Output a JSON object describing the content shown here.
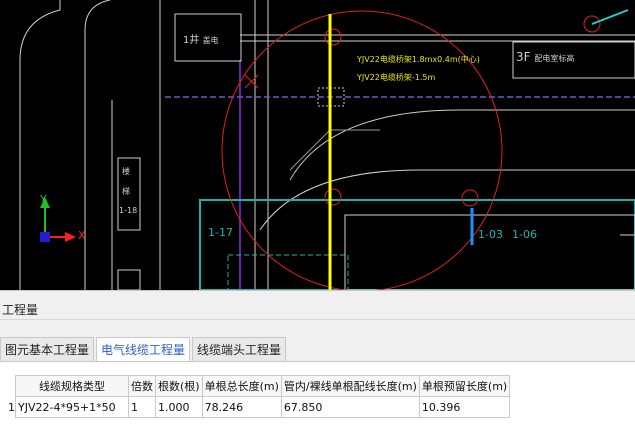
{
  "cad": {
    "labels": {
      "well": "1井",
      "well_suffix": "盖电",
      "floor_label": "3F",
      "floor_note": "配电室标高",
      "cable_note_1": "YJV22电缆桥架1.8mx0.4m(中心)",
      "cable_note_2": "YJV22电缆桥架-1.5m",
      "room_a": "1-17",
      "room_b": "1-03",
      "room_c": "1-06",
      "vertical_note_1": "楼",
      "vertical_note_2": "梯",
      "vertical_note_3": "1-18"
    },
    "axis": {
      "x_label": "X",
      "y_label": "Y"
    }
  },
  "panel": {
    "title": "工程量",
    "tabs": [
      {
        "label": "图元基本工程量",
        "active": false
      },
      {
        "label": "电气线缆工程量",
        "active": true
      },
      {
        "label": "线缆端头工程量",
        "active": false
      }
    ],
    "table": {
      "headers": [
        "线缆规格类型",
        "倍数",
        "根数(根)",
        "单根总长度(m)",
        "管内/裸线单根配线长度(m)",
        "单根预留长度(m)"
      ],
      "rows": [
        {
          "index": "1",
          "cells": [
            "YJV22-4*95+1*50",
            "1",
            "1.000",
            "78.246",
            "67.850",
            "10.396"
          ]
        }
      ]
    }
  },
  "colors": {
    "canvas_bg": "#000000",
    "selection_circle": "#e02020",
    "highlight_cable": "#ffff00",
    "room_outline": "#20b2aa",
    "riser": "#1e90ff",
    "active_tab_text": "#2f5ccf"
  }
}
